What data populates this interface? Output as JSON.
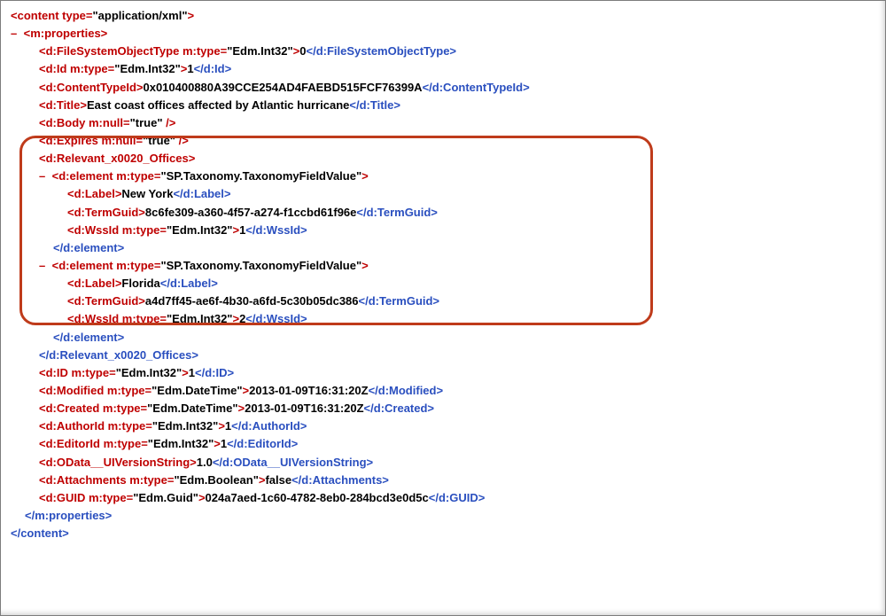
{
  "content_type": {
    "type_attr": "type",
    "type_val": "application/xml"
  },
  "props": {
    "FileSystemObjectType": {
      "attrname": "m:type",
      "attrval": "Edm.Int32",
      "value": "0"
    },
    "Id_lower": {
      "attrname": "m:type",
      "attrval": "Edm.Int32",
      "value": "1"
    },
    "ContentTypeId": {
      "value": "0x010400880A39CCE254AD4FAEBD515FCF76399A"
    },
    "Title": {
      "value": "East coast offices affected by Atlantic hurricane"
    },
    "Body": {
      "attrname": "m:null",
      "attrval": "true"
    },
    "Expires": {
      "attrname": "m:null",
      "attrval": "true"
    },
    "RelevantOffices": {
      "tag": "d:Relevant_x0020_Offices",
      "elements": [
        {
          "mtype": "SP.Taxonomy.TaxonomyFieldValue",
          "Label": "New York",
          "TermGuid": "8c6fe309-a360-4f57-a274-f1ccbd61f96e",
          "WssId": {
            "attrval": "Edm.Int32",
            "value": "1"
          }
        },
        {
          "mtype": "SP.Taxonomy.TaxonomyFieldValue",
          "Label": "Florida",
          "TermGuid": "a4d7ff45-ae6f-4b30-a6fd-5c30b05dc386",
          "WssId": {
            "attrval": "Edm.Int32",
            "value": "2"
          }
        }
      ]
    },
    "ID_upper": {
      "attrname": "m:type",
      "attrval": "Edm.Int32",
      "value": "1"
    },
    "Modified": {
      "attrname": "m:type",
      "attrval": "Edm.DateTime",
      "value": "2013-01-09T16:31:20Z"
    },
    "Created": {
      "attrname": "m:type",
      "attrval": "Edm.DateTime",
      "value": "2013-01-09T16:31:20Z"
    },
    "AuthorId": {
      "attrname": "m:type",
      "attrval": "Edm.Int32",
      "value": "1"
    },
    "EditorId": {
      "attrname": "m:type",
      "attrval": "Edm.Int32",
      "value": "1"
    },
    "OData__UIVersionString": {
      "value": "1.0"
    },
    "Attachments": {
      "attrname": "m:type",
      "attrval": "Edm.Boolean",
      "value": "false"
    },
    "GUID": {
      "attrname": "m:type",
      "attrval": "Edm.Guid",
      "value": "024a7aed-1c60-4782-8eb0-284bcd3e0d5c"
    }
  },
  "punct": {
    "open": "<",
    "close": ">",
    "slash": "/",
    "eq": "=",
    "q": "\"",
    "closeslash": " />"
  },
  "toggle": "–"
}
